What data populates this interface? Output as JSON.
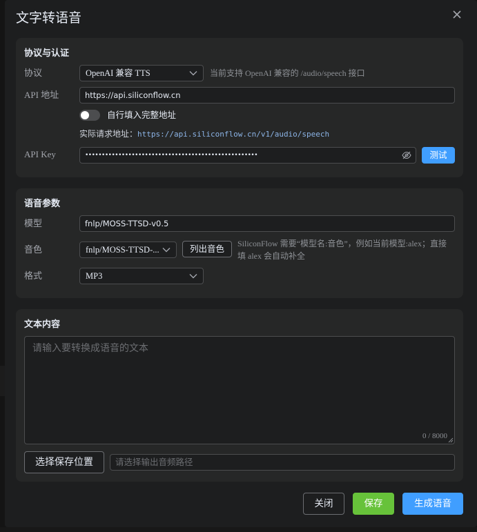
{
  "dialog": {
    "title": "文字转语音"
  },
  "protocol_section": {
    "title": "协议与认证",
    "protocol_label": "协议",
    "protocol_value": "OpenAI 兼容 TTS",
    "protocol_hint": "当前支持 OpenAI 兼容的 /audio/speech 接口",
    "api_url_label": "API 地址",
    "api_url_value": "https://api.siliconflow.cn",
    "full_url_toggle_label": "自行填入完整地址",
    "full_url_toggle_on": false,
    "actual_url_label": "实际请求地址：",
    "actual_url_value": "https://api.siliconflow.cn/v1/audio/speech",
    "api_key_label": "API Key",
    "api_key_value": "••••••••••••••••••••••••••••••••••••••••••••••••••••",
    "test_button": "测试"
  },
  "voice_section": {
    "title": "语音参数",
    "model_label": "模型",
    "model_value": "fnlp/MOSS-TTSD-v0.5",
    "voice_label": "音色",
    "voice_value": "fnlp/MOSS-TTSD-...",
    "list_voices_button": "列出音色",
    "voice_hint_line1": "SiliconFlow 需要“模型名:音色”，例如当前模型:alex；直接",
    "voice_hint_line2": "填 alex 会自动补全",
    "format_label": "格式",
    "format_value": "MP3"
  },
  "text_section": {
    "title": "文本内容",
    "text_placeholder": "请输入要转换成语音的文本",
    "char_count": "0 / 8000",
    "choose_location_button": "选择保存位置",
    "output_path_placeholder": "请选择输出音频路径"
  },
  "footer": {
    "close_button": "关闭",
    "save_button": "保存",
    "generate_button": "生成语音"
  },
  "colors": {
    "primary": "#409eff",
    "success": "#67c23a",
    "dialog_bg": "#1d1e1f",
    "section_bg": "#262727"
  },
  "icons": {
    "close": "close-icon",
    "dropdown": "chevron-down-icon",
    "password_toggle": "eye-off-icon"
  }
}
